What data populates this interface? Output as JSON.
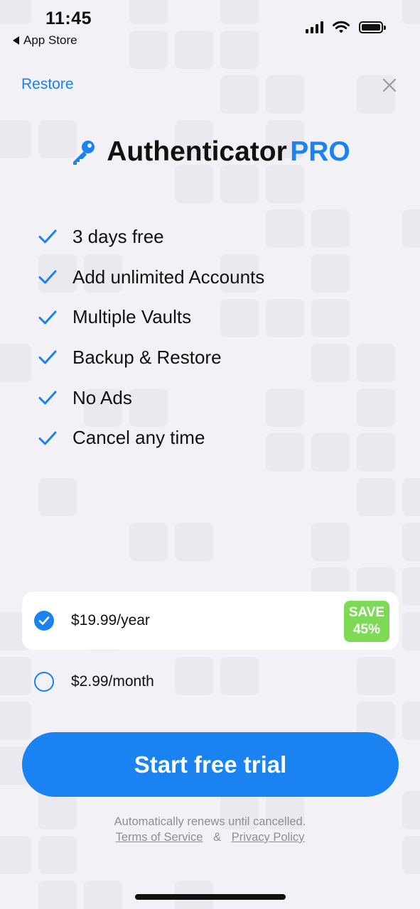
{
  "status_bar": {
    "time": "11:45",
    "back_label": "App Store",
    "icons": [
      "cellular-signal-icon",
      "wifi-icon",
      "battery-icon"
    ]
  },
  "nav": {
    "restore_label": "Restore",
    "close_icon": "close-icon"
  },
  "title": {
    "icon": "key-icon",
    "text": "Authenticator",
    "highlight": "PRO"
  },
  "features": [
    {
      "label": "3 days free",
      "icon": "checkmark-icon"
    },
    {
      "label": "Add unlimited Accounts",
      "icon": "checkmark-icon"
    },
    {
      "label": "Multiple Vaults",
      "icon": "checkmark-icon"
    },
    {
      "label": "Backup & Restore",
      "icon": "checkmark-icon"
    },
    {
      "label": "No Ads",
      "icon": "checkmark-icon"
    },
    {
      "label": "Cancel any time",
      "icon": "checkmark-icon"
    }
  ],
  "plans": [
    {
      "label": "$19.99/year",
      "selected": true,
      "badge_line1": "SAVE",
      "badge_line2": "45%"
    },
    {
      "label": "$2.99/month",
      "selected": false
    }
  ],
  "cta": {
    "label": "Start free trial"
  },
  "footer": {
    "renew_text": "Automatically renews until cancelled.",
    "terms_label": "Terms of Service",
    "ampersand": "&",
    "privacy_label": "Privacy Policy"
  },
  "colors": {
    "accent": "#1a82f1",
    "link": "#1a7ff0",
    "badge": "#7ed957",
    "background": "#f1f1f6",
    "footer_text": "#8e8e93"
  }
}
